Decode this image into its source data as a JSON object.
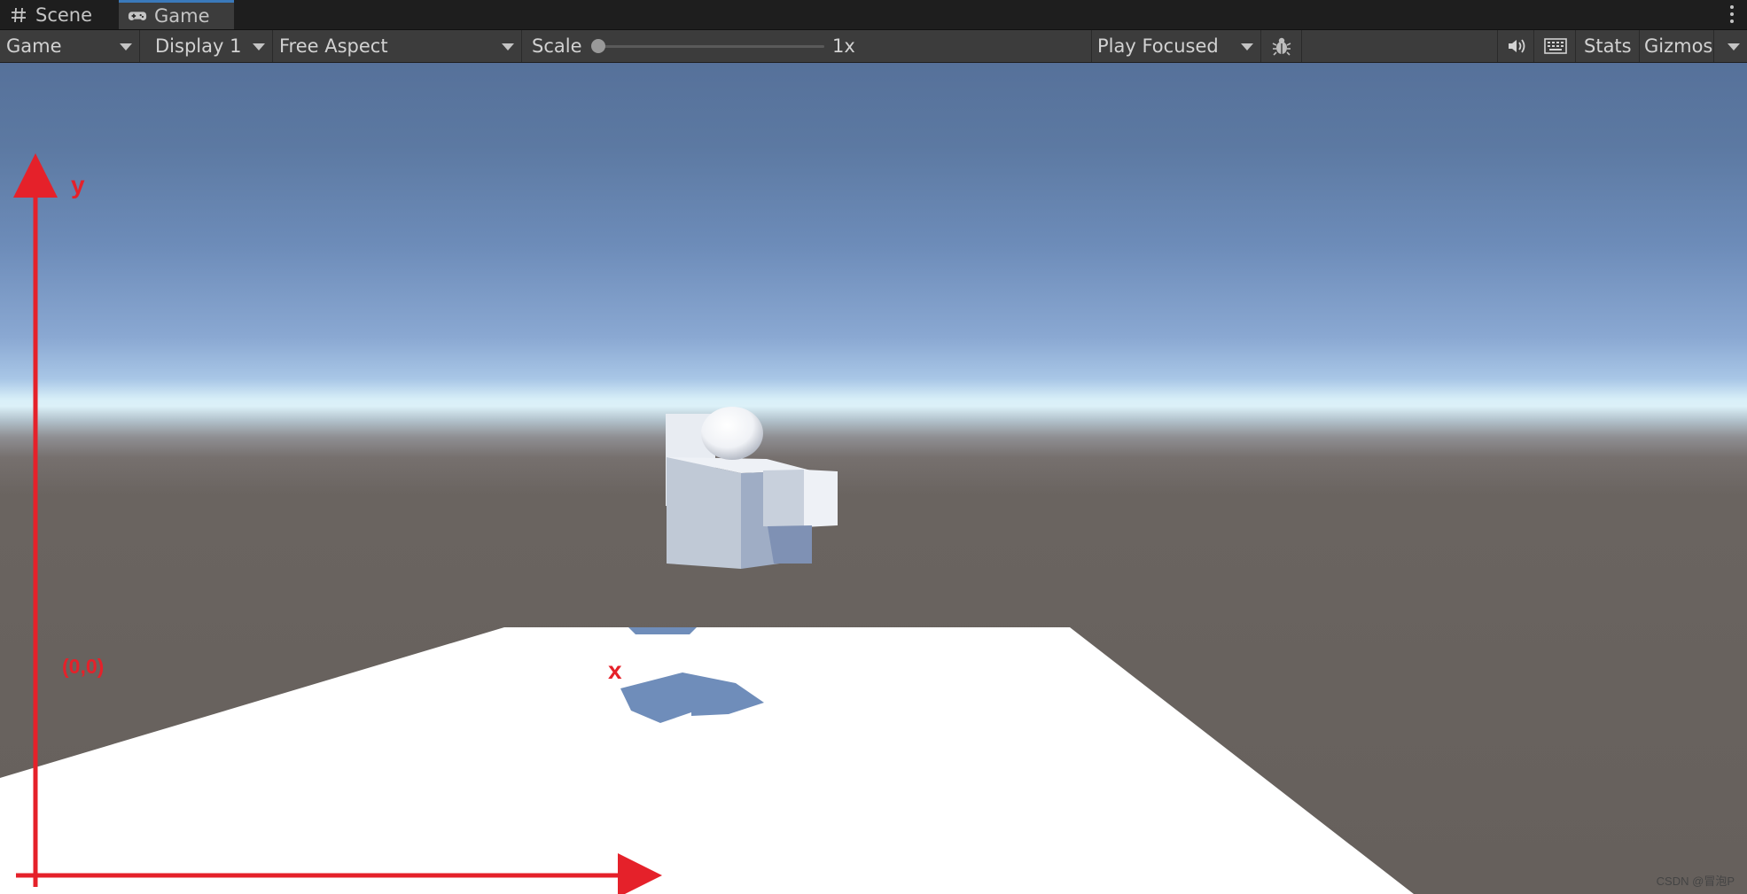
{
  "tabs": [
    {
      "label": "Scene",
      "icon": "grid-hash-icon",
      "active": false
    },
    {
      "label": "Game",
      "icon": "gamepad-icon",
      "active": true
    }
  ],
  "toolbar": {
    "view_mode": "Game",
    "display": "Display 1",
    "aspect": "Free Aspect",
    "scale_label": "Scale",
    "scale_value": "1x",
    "play_mode": "Play Focused",
    "stats_label": "Stats",
    "gizmos_label": "Gizmos"
  },
  "annotations": {
    "y_label": "y",
    "x_label": "x",
    "origin_label": "(0,0)",
    "axis_color": "#e5212a"
  },
  "watermark": "CSDN @冒泡P",
  "colors": {
    "tab_active_indicator": "#3a79bb",
    "sky_top": "#56719a",
    "horizon": "#dcf1f8",
    "ground": "#66605c",
    "plane": "#ffffff",
    "shadow": "#6f8dba"
  }
}
